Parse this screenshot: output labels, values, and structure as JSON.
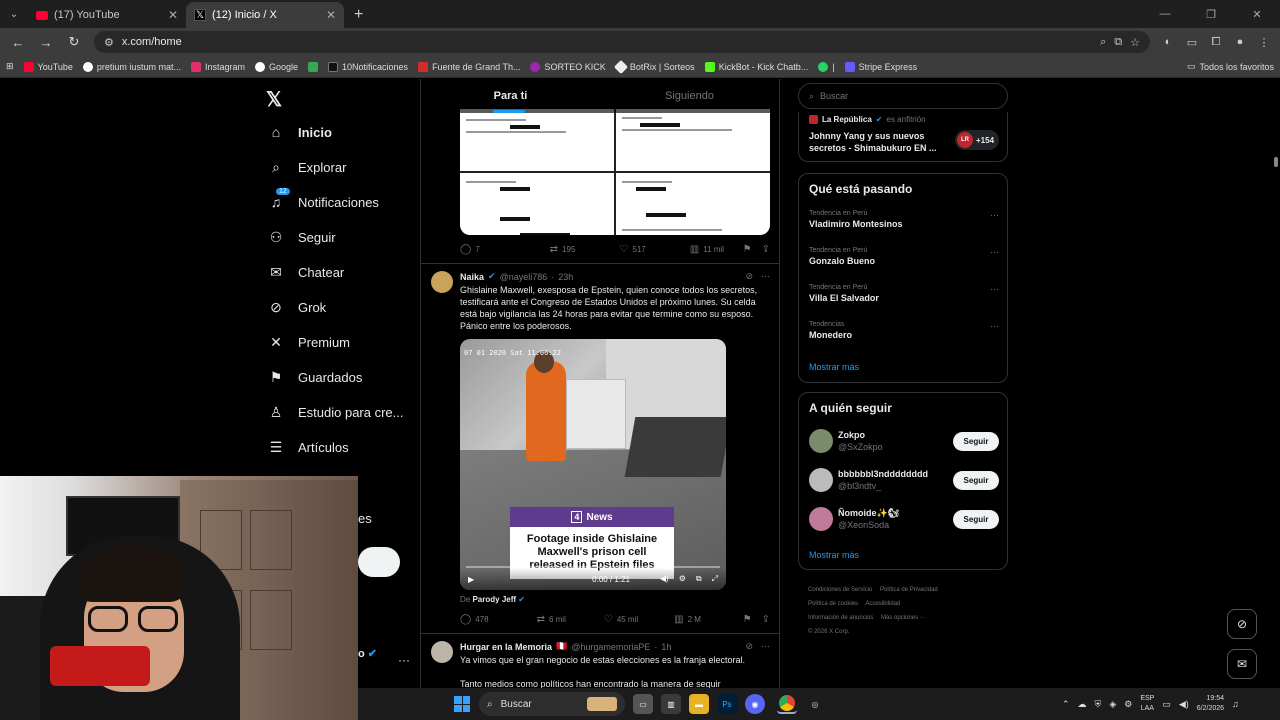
{
  "browser": {
    "tabs": [
      {
        "title": "(17) YouTube",
        "icon": "youtube-icon"
      },
      {
        "title": "(12) Inicio / X",
        "icon": "x-icon"
      }
    ],
    "url": "x.com/home",
    "bookmarks": [
      {
        "label": "YouTube",
        "color": "#ff0033"
      },
      {
        "label": "pretium iustum mat...",
        "color": "#ffffff"
      },
      {
        "label": "Instagram",
        "color": "#e1306c"
      },
      {
        "label": "Google",
        "color": "#4285f4"
      },
      {
        "label": "",
        "color": "#34a853"
      },
      {
        "label": "10Notificaciones",
        "color": "#111111"
      },
      {
        "label": "Fuente de Grand Th...",
        "color": "#d62b2b"
      },
      {
        "label": "SORTEO KICK",
        "color": "#9b27af"
      },
      {
        "label": "BotRix | Sorteos",
        "color": "#eeeeee"
      },
      {
        "label": "KickBot - Kick Chatb...",
        "color": "#53fc18"
      },
      {
        "label": "|",
        "color": "#25d366"
      },
      {
        "label": "Stripe Express",
        "color": "#635bff"
      }
    ],
    "all_bookmarks": "Todos los favoritos"
  },
  "nav": {
    "items": [
      {
        "label": "Inicio",
        "icon": "home-icon",
        "glyph": "⌂"
      },
      {
        "label": "Explorar",
        "icon": "search-icon",
        "glyph": "⌕"
      },
      {
        "label": "Notificaciones",
        "icon": "bell-icon",
        "glyph": "🔔︎",
        "badge": "12"
      },
      {
        "label": "Seguir",
        "icon": "add-person-icon",
        "glyph": "⚇"
      },
      {
        "label": "Chatear",
        "icon": "mail-icon",
        "glyph": "✉"
      },
      {
        "label": "Grok",
        "icon": "grok-icon",
        "glyph": "⊘"
      },
      {
        "label": "Premium",
        "icon": "x-icon",
        "glyph": "✕"
      },
      {
        "label": "Guardados",
        "icon": "bookmark-icon",
        "glyph": "⚑"
      },
      {
        "label": "Estudio para cre...",
        "icon": "studio-icon",
        "glyph": "♙"
      },
      {
        "label": "Artículos",
        "icon": "article-icon",
        "glyph": "☰"
      }
    ],
    "more_fragment": "es",
    "account_fragment": "o"
  },
  "feed": {
    "tabs": [
      "Para ti",
      "Siguiendo"
    ],
    "tweet1_actions": {
      "replies": "7",
      "retweets": "195",
      "likes": "517",
      "views": "11 mil"
    },
    "tweet2": {
      "name": "Naika",
      "handle": "@nayeli786",
      "time": "23h",
      "text": "Ghislaine Maxwell, exesposa de Epstein, quien conoce todos los secretos, testificará ante el Congreso de Estados Unidos el próximo lunes. Su celda está bajo vigilancia las 24 horas para evitar que termine como su esposo. Pánico entre los poderosos.",
      "video_timestamp": "07 01 2020 Sat 11:06:22",
      "news_brand": "News",
      "news_number": "4",
      "caption": "Footage inside Ghislaine Maxwell's prison cell released in Epstein files",
      "video_time": "0:00 / 1:21",
      "from_label": "De",
      "from_account": "Parody Jeff",
      "actions": {
        "replies": "478",
        "retweets": "6 mil",
        "likes": "45 mil",
        "views": "2 M"
      }
    },
    "tweet3": {
      "name": "Hurgar en la Memoria",
      "flag": "🇵🇪",
      "handle": "@hurgamemoriaPE",
      "time": "1h",
      "text_line1": "Ya vimos que el gran negocio de estas elecciones es la franja electoral.",
      "text_line2": "Tanto medios como políticos han encontrado la manera de seguir"
    }
  },
  "sidebar": {
    "search_placeholder": "Buscar",
    "live": {
      "source": "La República",
      "host_label": "es anfitrión",
      "title": "Johnny Yang y sus nuevos secretos - Shimabukuro EN ...",
      "logo": "LR",
      "count": "+154"
    },
    "trends_title": "Qué está pasando",
    "trends": [
      {
        "context": "Tendencia en Perú",
        "name": "Vladimiro Montesinos"
      },
      {
        "context": "Tendencia en Perú",
        "name": "Gonzalo Bueno"
      },
      {
        "context": "Tendencia en Perú",
        "name": "Villa El Salvador"
      },
      {
        "context": "Tendencias",
        "name": "Monedero"
      }
    ],
    "show_more": "Mostrar más",
    "follow_title": "A quién seguir",
    "follow": [
      {
        "name": "Zokpo",
        "handle": "@SxZokpo",
        "button": "Seguir",
        "color": "#7a8a6a"
      },
      {
        "name": "bbbbbbl3ndddddddd",
        "handle": "@bl3ndtv_",
        "button": "Seguir",
        "color": "#bbbbbb"
      },
      {
        "name": "Ñomoide✨🐿",
        "handle": "@XeonSoda",
        "button": "Seguir",
        "color": "#c07a9a"
      }
    ],
    "footer": [
      "Condiciones de Servicio",
      "Política de Privacidad",
      "Política de cookies",
      "Accesibilidad",
      "Información de anuncios",
      "Más opciones ···",
      "© 2026 X Corp."
    ]
  },
  "taskbar": {
    "search": "Buscar",
    "lang_top": "ESP",
    "lang_bottom": "LAA",
    "time": "19:54",
    "date": "6/2/2026"
  }
}
